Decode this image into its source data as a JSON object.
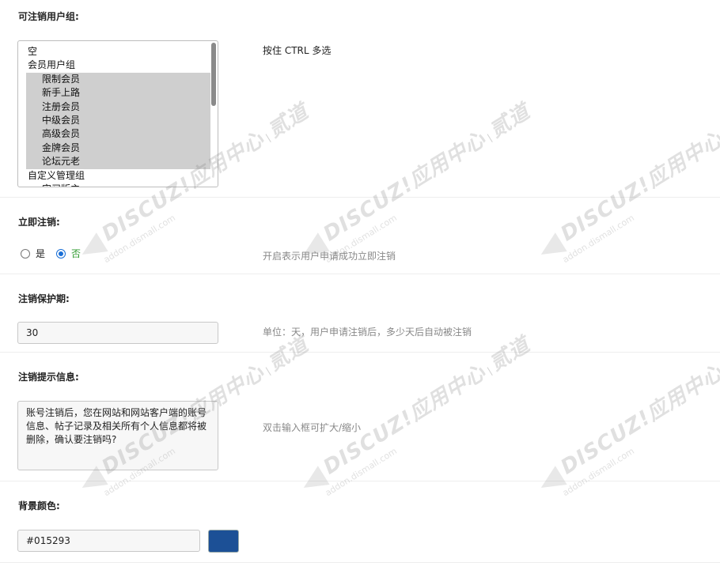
{
  "section_groups": {
    "label": "可注销用户组:",
    "hint": "按住 CTRL 多选",
    "options": [
      {
        "text": "空",
        "type": "item"
      },
      {
        "text": "会员用户组",
        "type": "group"
      },
      {
        "text": "限制会员",
        "type": "child"
      },
      {
        "text": "新手上路",
        "type": "child"
      },
      {
        "text": "注册会员",
        "type": "child"
      },
      {
        "text": "中级会员",
        "type": "child"
      },
      {
        "text": "高级会员",
        "type": "child"
      },
      {
        "text": "金牌会员",
        "type": "child"
      },
      {
        "text": "论坛元老",
        "type": "child"
      },
      {
        "text": "自定义管理组",
        "type": "group"
      },
      {
        "text": "实习版主",
        "type": "child-partial"
      }
    ]
  },
  "section_immediate": {
    "label": "立即注销:",
    "yes_label": "是",
    "no_label": "否",
    "hint": "开启表示用户申请成功立即注销"
  },
  "section_protect": {
    "label": "注销保护期:",
    "value": "30",
    "hint": "单位：天，用户申请注销后，多少天后自动被注销"
  },
  "section_message": {
    "label": "注销提示信息:",
    "value": "账号注销后，您在网站和网站客户端的账号信息、帖子记录及相关所有个人信息都将被删除，确认要注销吗?",
    "hint": "双击输入框可扩大/缩小"
  },
  "section_bgcolor": {
    "label": "背景颜色:",
    "value": "#015293",
    "swatch_color": "#1c5096"
  },
  "colors": {
    "selected_option_bg": "#cfcfcf",
    "radio_accent": "#1a6fd6",
    "checked_label": "#2e9a2e"
  },
  "watermark": {
    "brand": "DISCUZ!应用中心",
    "brand2": "贰道",
    "domain": "addon.dismall.com"
  }
}
